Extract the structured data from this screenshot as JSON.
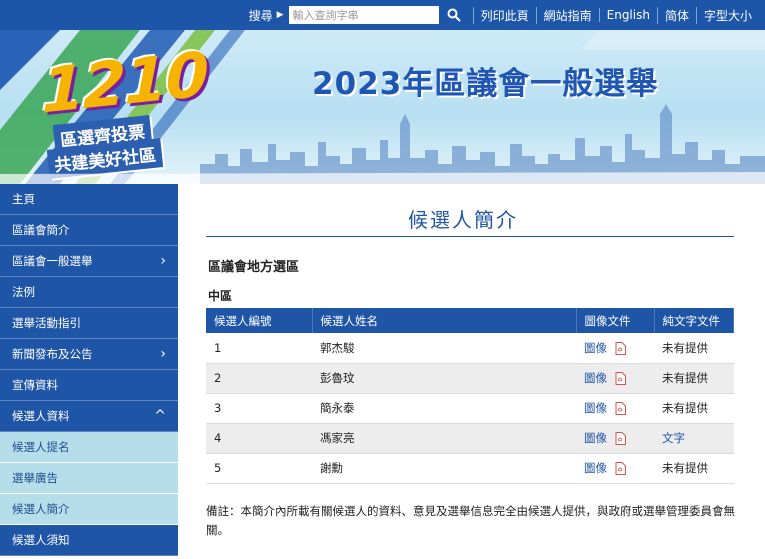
{
  "topbar": {
    "search_label": "搜尋",
    "search_placeholder": "輸入查詢字串",
    "links": [
      "列印此頁",
      "網站指南",
      "English",
      "简体",
      "字型大小"
    ]
  },
  "banner": {
    "logo_number": "1210",
    "logo_line1": "區選齊投票",
    "logo_line2": "共建美好社區",
    "title": "2023年區議會一般選舉"
  },
  "sidebar": {
    "items": [
      {
        "label": "主頁",
        "chevron": ""
      },
      {
        "label": "區議會簡介",
        "chevron": ""
      },
      {
        "label": "區議會一般選舉",
        "chevron": "›"
      },
      {
        "label": "法例",
        "chevron": ""
      },
      {
        "label": "選舉活動指引",
        "chevron": ""
      },
      {
        "label": "新聞發布及公告",
        "chevron": "›"
      },
      {
        "label": "宣傳資料",
        "chevron": ""
      },
      {
        "label": "候選人資料",
        "chevron": "^"
      },
      {
        "label": "候選人提名",
        "chevron": ""
      },
      {
        "label": "選舉廣告",
        "chevron": ""
      },
      {
        "label": "候選人簡介",
        "chevron": ""
      },
      {
        "label": "候選人須知",
        "chevron": ""
      }
    ]
  },
  "main": {
    "title": "候選人簡介",
    "section_heading": "區議會地方選區",
    "district": "中區",
    "table": {
      "headers": [
        "候選人編號",
        "候選人姓名",
        "圖像文件",
        "純文字文件"
      ],
      "rows": [
        {
          "no": "1",
          "name": "郭杰駿",
          "image": "圖像",
          "text": "未有提供",
          "text_link": false
        },
        {
          "no": "2",
          "name": "彭魯玟",
          "image": "圖像",
          "text": "未有提供",
          "text_link": false
        },
        {
          "no": "3",
          "name": "簡永泰",
          "image": "圖像",
          "text": "未有提供",
          "text_link": false
        },
        {
          "no": "4",
          "name": "馮家亮",
          "image": "圖像",
          "text": "文字",
          "text_link": true
        },
        {
          "no": "5",
          "name": "謝勳",
          "image": "圖像",
          "text": "未有提供",
          "text_link": false
        }
      ]
    },
    "note": "備註：本簡介內所載有關候選人的資料、意見及選舉信息完全由候選人提供，與政府或選舉管理委員會無關。"
  },
  "colors": {
    "primary_blue": "#1f55a6",
    "sub_menu_bg": "#b5ddea",
    "logo_gold": "#f6b400"
  }
}
